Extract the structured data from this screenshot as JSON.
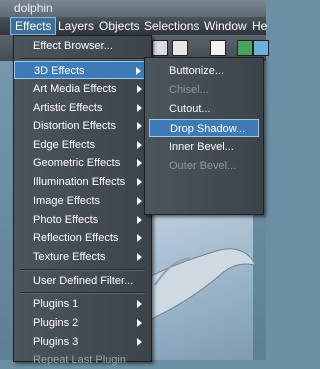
{
  "window": {
    "title": "dolphin"
  },
  "menubar": [
    "Effects",
    "Layers",
    "Objects",
    "Selections",
    "Window",
    "He"
  ],
  "effects_menu": {
    "effect_browser": "Effect Browser...",
    "items": [
      "3D Effects",
      "Art Media Effects",
      "Artistic Effects",
      "Distortion Effects",
      "Edge Effects",
      "Geometric Effects",
      "Illumination Effects",
      "Image Effects",
      "Photo Effects",
      "Reflection Effects",
      "Texture Effects"
    ],
    "user_defined": "User Defined Filter...",
    "plugins": [
      "Plugins 1",
      "Plugins 2",
      "Plugins 3"
    ],
    "repeat": "Repeat Last Plugin"
  },
  "submenu_3d": [
    "Buttonize...",
    "Chisel...",
    "Cutout...",
    "Drop Shadow...",
    "Inner Bevel...",
    "Outer Bevel..."
  ],
  "colors": {
    "highlight": "#3e7bb6",
    "menu_bg": "#444c53"
  }
}
